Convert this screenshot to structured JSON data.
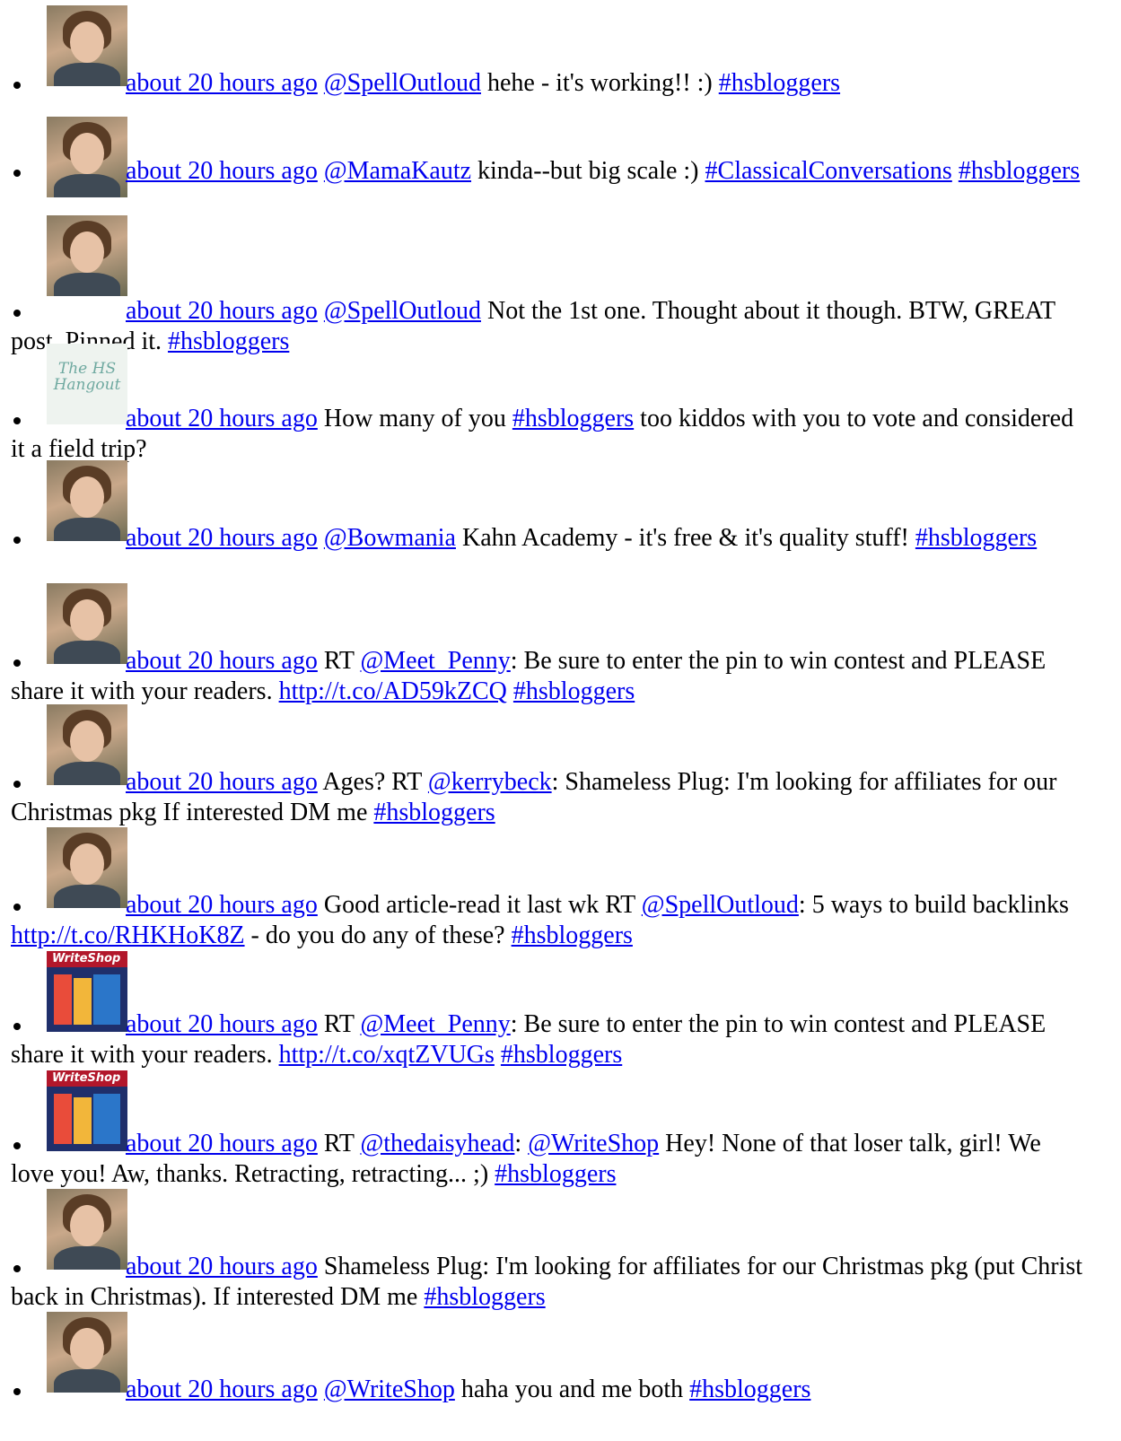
{
  "colors": {
    "link": "#0000ee",
    "text": "#000000",
    "background": "#ffffff"
  },
  "tweets": [
    {
      "avatar": "profile-photo",
      "time": "about 20 hours ago",
      "parts": [
        {
          "t": "l",
          "v": "@SpellOutloud"
        },
        {
          "t": "s",
          "v": " hehe - it's working!! :) "
        },
        {
          "t": "l",
          "v": "#hsbloggers"
        }
      ]
    },
    {
      "avatar": "profile-photo",
      "time": "about 20 hours ago",
      "parts": [
        {
          "t": "l",
          "v": "@MamaKautz"
        },
        {
          "t": "s",
          "v": " kinda--but big scale :) "
        },
        {
          "t": "l",
          "v": "#ClassicalConversations"
        },
        {
          "t": "s",
          "v": " "
        },
        {
          "t": "l",
          "v": "#hsbloggers"
        }
      ]
    },
    {
      "avatar": "profile-photo",
      "time": "about 20 hours ago",
      "parts": [
        {
          "t": "l",
          "v": "@SpellOutloud"
        },
        {
          "t": "s",
          "v": " Not the 1st one. Thought about it though. BTW, GREAT post. Pinned it. "
        },
        {
          "t": "l",
          "v": "#hsbloggers"
        }
      ]
    },
    {
      "avatar": "logo",
      "logo_text": "The HS Hangout",
      "time": "about 20 hours ago",
      "parts": [
        {
          "t": "s",
          "v": " How many of you "
        },
        {
          "t": "l",
          "v": "#hsbloggers"
        },
        {
          "t": "s",
          "v": " too kiddos with you to vote and considered it a field trip?"
        }
      ]
    },
    {
      "avatar": "profile-photo",
      "time": "about 20 hours ago",
      "parts": [
        {
          "t": "l",
          "v": "@Bowmania"
        },
        {
          "t": "s",
          "v": " Kahn Academy - it's free & it's quality stuff! "
        },
        {
          "t": "l",
          "v": "#hsbloggers"
        }
      ]
    },
    {
      "avatar": "profile-photo",
      "time": "about 20 hours ago",
      "parts": [
        {
          "t": "s",
          "v": " RT "
        },
        {
          "t": "l",
          "v": "@Meet_Penny"
        },
        {
          "t": "s",
          "v": ": Be sure to enter the pin to win contest and PLEASE share it with your readers. "
        },
        {
          "t": "l",
          "v": "http://t.co/AD59kZCQ"
        },
        {
          "t": "s",
          "v": " "
        },
        {
          "t": "l",
          "v": "#hsbloggers"
        }
      ]
    },
    {
      "avatar": "profile-photo",
      "time": "about 20 hours ago",
      "parts": [
        {
          "t": "s",
          "v": " Ages? RT "
        },
        {
          "t": "l",
          "v": "@kerrybeck"
        },
        {
          "t": "s",
          "v": ": Shameless Plug: I'm looking for affiliates for our Christmas pkg If interested DM me "
        },
        {
          "t": "l",
          "v": "#hsbloggers"
        }
      ]
    },
    {
      "avatar": "profile-photo",
      "time": "about 20 hours ago",
      "parts": [
        {
          "t": "s",
          "v": " Good article-read it last wk RT "
        },
        {
          "t": "l",
          "v": "@SpellOutloud"
        },
        {
          "t": "s",
          "v": ": 5 ways to build backlinks "
        },
        {
          "t": "l",
          "v": "http://t.co/RHKHoK8Z"
        },
        {
          "t": "s",
          "v": " - do you do any of these? "
        },
        {
          "t": "l",
          "v": "#hsbloggers"
        }
      ]
    },
    {
      "avatar": "book",
      "logo_text": "WriteShop",
      "time": "about 20 hours ago",
      "parts": [
        {
          "t": "s",
          "v": " RT "
        },
        {
          "t": "l",
          "v": "@Meet_Penny"
        },
        {
          "t": "s",
          "v": ": Be sure to enter the pin to win contest and PLEASE share it with your readers. "
        },
        {
          "t": "l",
          "v": "http://t.co/xqtZVUGs"
        },
        {
          "t": "s",
          "v": " "
        },
        {
          "t": "l",
          "v": "#hsbloggers"
        }
      ]
    },
    {
      "avatar": "book",
      "logo_text": "WriteShop",
      "time": "about 20 hours ago",
      "parts": [
        {
          "t": "s",
          "v": " RT "
        },
        {
          "t": "l",
          "v": "@thedaisyhead"
        },
        {
          "t": "s",
          "v": ": "
        },
        {
          "t": "l",
          "v": "@WriteShop"
        },
        {
          "t": "s",
          "v": " Hey! None of that loser talk, girl! We love you! Aw, thanks. Retracting, retracting... ;) "
        },
        {
          "t": "l",
          "v": "#hsbloggers"
        }
      ]
    },
    {
      "avatar": "profile-photo",
      "time": "about 20 hours ago",
      "parts": [
        {
          "t": "s",
          "v": " Shameless Plug: I'm looking for affiliates for our Christmas pkg (put Christ back in Christmas). If interested DM me "
        },
        {
          "t": "l",
          "v": "#hsbloggers"
        }
      ]
    },
    {
      "avatar": "profile-photo",
      "time": "about 20 hours ago",
      "parts": [
        {
          "t": "l",
          "v": "@WriteShop"
        },
        {
          "t": "s",
          "v": " haha you and me both "
        },
        {
          "t": "l",
          "v": "#hsbloggers"
        }
      ]
    }
  ]
}
